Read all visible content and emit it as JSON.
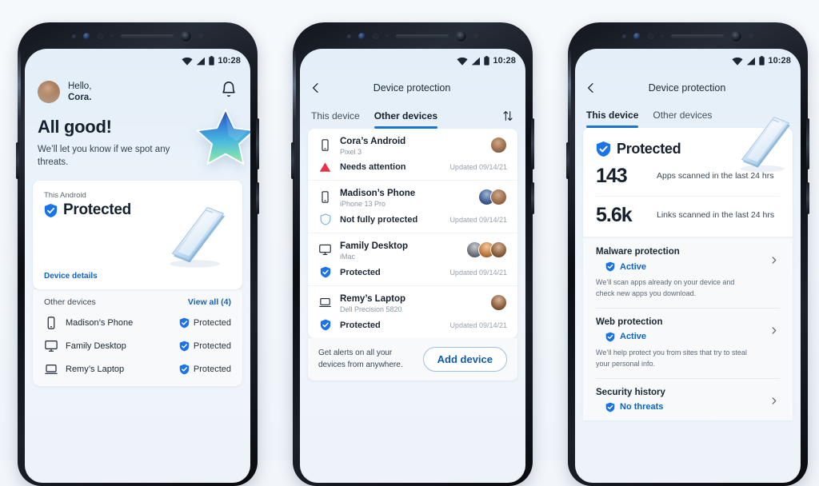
{
  "status_bar": {
    "time": "10:28",
    "icons": [
      "wifi-icon",
      "signal-icon",
      "battery-icon"
    ]
  },
  "phone1": {
    "greeting_line1": "Hello,",
    "greeting_line2": "Cora.",
    "bell_icon": "notification-bell-icon",
    "headline": "All good!",
    "subhead": "We’ll let you know if we spot any threats.",
    "hero_icon": "star-icon",
    "card": {
      "label": "This Android",
      "status": "Protected",
      "status_icon": "shield-check-icon",
      "link": "Device details",
      "illustration": "smartphone-3d-icon"
    },
    "other": {
      "title": "Other devices",
      "view_all": "View all (4)",
      "rows": [
        {
          "icon": "smartphone-icon",
          "name": "Madison’s Phone",
          "status": "Protected",
          "status_icon": "shield-check-icon"
        },
        {
          "icon": "desktop-icon",
          "name": "Family Desktop",
          "status": "Protected",
          "status_icon": "shield-check-icon"
        },
        {
          "icon": "laptop-icon",
          "name": "Remy’s Laptop",
          "status": "Protected",
          "status_icon": "shield-check-icon"
        }
      ]
    }
  },
  "phone2": {
    "nav_title": "Device protection",
    "back_icon": "chevron-left-icon",
    "sort_icon": "sort-arrows-icon",
    "tabs": [
      {
        "label": "This device",
        "active": false
      },
      {
        "label": "Other devices",
        "active": true
      }
    ],
    "devices": [
      {
        "icon": "smartphone-icon",
        "name": "Cora’s Android",
        "model": "Pixel 3",
        "status": "Needs attention",
        "status_icon": "warning-triangle-icon",
        "updated": "Updated 09/14/21",
        "avatars": 1
      },
      {
        "icon": "smartphone-icon",
        "name": "Madison’s Phone",
        "model": "iPhone 13 Pro",
        "status": "Not fully protected",
        "status_icon": "shield-outline-icon",
        "updated": "Updated 09/14/21",
        "avatars": 2
      },
      {
        "icon": "desktop-icon",
        "name": "Family Desktop",
        "model": "iMac",
        "status": "Protected",
        "status_icon": "shield-check-icon",
        "updated": "Updated 09/14/21",
        "avatars": 3
      },
      {
        "icon": "laptop-icon",
        "name": "Remy’s Laptop",
        "model": "Dell Precision 5820",
        "status": "Protected",
        "status_icon": "shield-check-icon",
        "updated": "Updated 09/14/21",
        "avatars": 1
      }
    ],
    "footer": {
      "text": "Get alerts on all your devices from anywhere.",
      "button": "Add device"
    }
  },
  "phone3": {
    "nav_title": "Device protection",
    "back_icon": "chevron-left-icon",
    "tabs": [
      {
        "label": "This device",
        "active": true
      },
      {
        "label": "Other devices",
        "active": false
      }
    ],
    "illustration": "smartphone-3d-icon",
    "status": "Protected",
    "status_icon": "shield-check-icon",
    "stats": [
      {
        "value": "143",
        "label": "Apps scanned in the last 24 hrs"
      },
      {
        "value": "5.6k",
        "label": "Links scanned in the last 24 hrs"
      }
    ],
    "sections": [
      {
        "title": "Malware protection",
        "value": "Active",
        "value_icon": "shield-check-icon",
        "desc": "We’ll scan apps already on your device and check new apps you download.",
        "chevron": "chevron-right-icon"
      },
      {
        "title": "Web protection",
        "value": "Active",
        "value_icon": "shield-check-icon",
        "desc": "We’ll help protect you from sites that try to steal your personal info.",
        "chevron": "chevron-right-icon"
      },
      {
        "title": "Security history",
        "value": "No threats",
        "value_icon": "shield-check-icon",
        "desc": "",
        "chevron": "chevron-right-icon"
      }
    ]
  },
  "colors": {
    "accent_blue": "#0f63c4",
    "tab_underline": "#1877cc",
    "shield_blue": "#1a73e8",
    "warning_red": "#e8304a",
    "page_background": "#f2f6fb"
  }
}
